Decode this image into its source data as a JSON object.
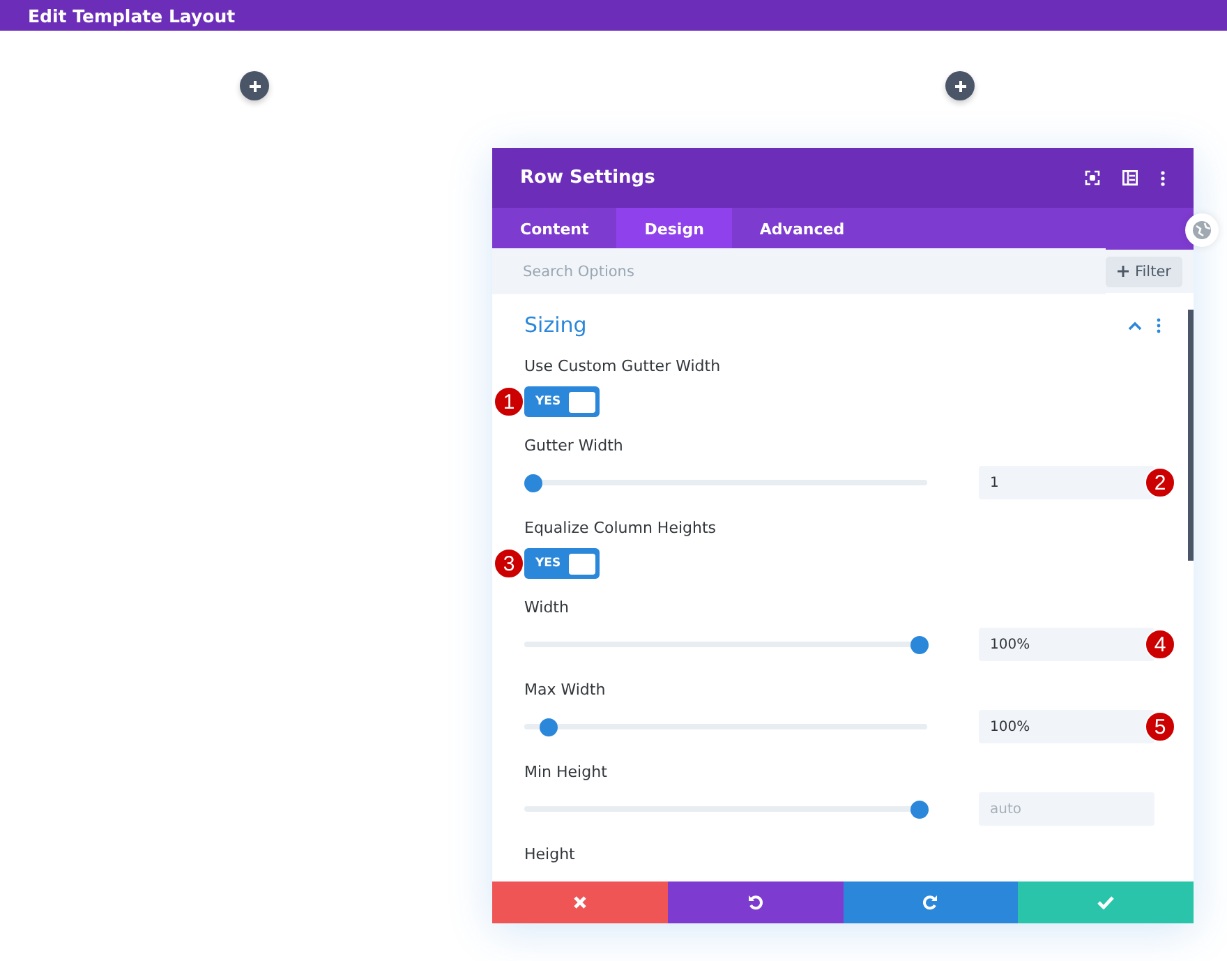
{
  "top_bar": {
    "title": "Edit Template Layout"
  },
  "modal": {
    "title": "Row Settings",
    "tabs": [
      {
        "label": "Content",
        "selected": false
      },
      {
        "label": "Design",
        "selected": true
      },
      {
        "label": "Advanced",
        "selected": false
      }
    ],
    "search": {
      "placeholder": "Search Options"
    },
    "filter_button": "Filter",
    "section": {
      "title": "Sizing",
      "expanded": true
    },
    "settings": [
      {
        "kind": "toggle",
        "label": "Use Custom Gutter Width",
        "on": true,
        "toggle_text": "YES",
        "badge": "1"
      },
      {
        "kind": "slider",
        "label": "Gutter Width",
        "level": 0.02,
        "value": "1",
        "badge": "2"
      },
      {
        "kind": "toggle",
        "label": "Equalize Column Heights",
        "on": true,
        "toggle_text": "YES",
        "badge": "3"
      },
      {
        "kind": "slider",
        "label": "Width",
        "level": 0.98,
        "value": "100%",
        "badge": "4"
      },
      {
        "kind": "slider",
        "label": "Max Width",
        "level": 0.06,
        "value": "100%",
        "badge": "5"
      },
      {
        "kind": "slider",
        "label": "Min Height",
        "level": 0.98,
        "placeholder": "auto"
      },
      {
        "kind": "label",
        "label": "Height"
      }
    ]
  }
}
